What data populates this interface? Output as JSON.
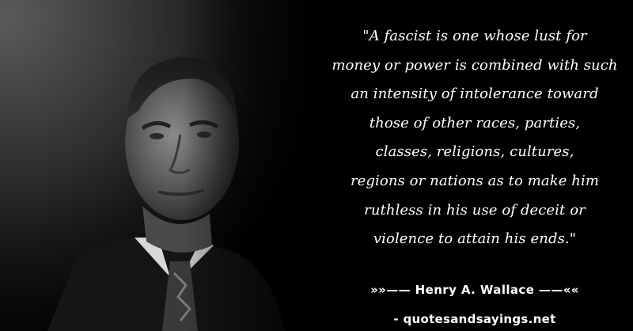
{
  "quote": {
    "lines": [
      "\"A fascist is one whose lust for",
      "money or power is combined with such",
      "an intensity of intolerance toward",
      "those of other races, parties,",
      "classes, religions, cultures,",
      "regions or nations as to make him",
      "ruthless in his use of deceit or",
      "violence to attain his ends.\""
    ]
  },
  "author_line": "»»—— Henry A. Wallace ——««",
  "source_line": "- quotesandsayings.net",
  "colors": {
    "background": "#000000",
    "text": "#ffffff"
  }
}
